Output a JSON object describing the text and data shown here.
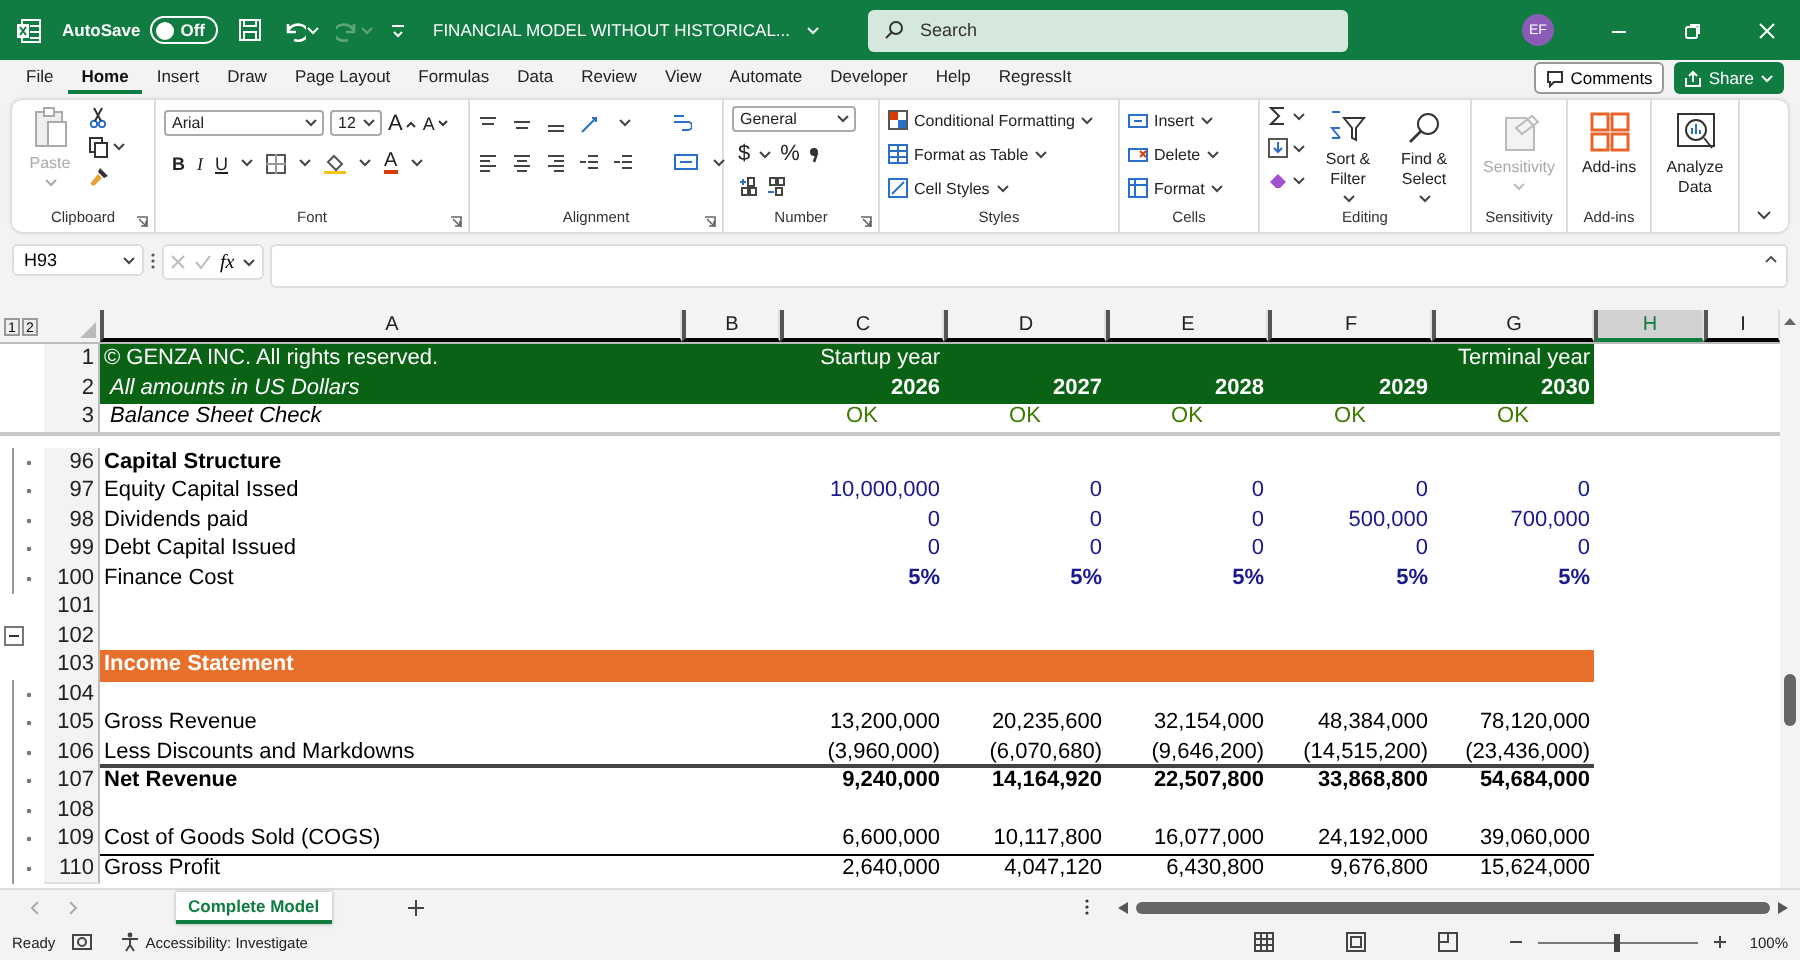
{
  "title_bar": {
    "autosave_label": "AutoSave",
    "autosave": {
      "label": "Off",
      "on": false
    },
    "redo_disabled": true,
    "document_title": "FINANCIAL MODEL WITHOUT HISTORICAL...",
    "search": {
      "placeholder": "Search"
    },
    "user_initials": "EF"
  },
  "menu": {
    "tabs": [
      {
        "label": "File",
        "selected": false
      },
      {
        "label": "Home",
        "selected": true
      },
      {
        "label": "Insert",
        "selected": false
      },
      {
        "label": "Draw",
        "selected": false
      },
      {
        "label": "Page Layout",
        "selected": false
      },
      {
        "label": "Formulas",
        "selected": false
      },
      {
        "label": "Data",
        "selected": false
      },
      {
        "label": "Review",
        "selected": false
      },
      {
        "label": "View",
        "selected": false
      },
      {
        "label": "Automate",
        "selected": false
      },
      {
        "label": "Developer",
        "selected": false
      },
      {
        "label": "Help",
        "selected": false
      },
      {
        "label": "RegressIt",
        "selected": false
      }
    ],
    "comments_button": "Comments",
    "share_button": "Share"
  },
  "ribbon": {
    "groups": [
      {
        "kind": "clipboard",
        "label": "Clipboard",
        "paste": {
          "label": "Paste",
          "disabled": true
        }
      },
      {
        "kind": "font",
        "label": "Font",
        "font_name": "Arial",
        "font_size": "12",
        "grow": "A",
        "shrink": "A",
        "bold": "B",
        "italic": "I",
        "underline": "U",
        "font_color": "A"
      },
      {
        "kind": "alignment",
        "label": "Alignment"
      },
      {
        "kind": "number",
        "label": "Number",
        "format": "General",
        "currency": "$",
        "percent": "%"
      },
      {
        "kind": "list",
        "label": "Styles",
        "items": [
          {
            "label": "Conditional Formatting"
          },
          {
            "label": "Format as Table"
          },
          {
            "label": "Cell Styles"
          }
        ]
      },
      {
        "kind": "list",
        "label": "Cells",
        "items": [
          {
            "label": "Insert"
          },
          {
            "label": "Delete"
          },
          {
            "label": "Format"
          }
        ]
      },
      {
        "kind": "editing",
        "label": "Editing",
        "buttons": [
          {
            "label": "Sort & Filter"
          },
          {
            "label": "Find & Select"
          }
        ]
      },
      {
        "kind": "sensitivity",
        "label": "Sensitivity",
        "button": {
          "label": "Sensitivity",
          "disabled": true
        }
      },
      {
        "kind": "addins",
        "label": "Add-ins",
        "button": {
          "label": "Add-ins",
          "disabled": false
        }
      },
      {
        "kind": "analyze",
        "button": {
          "label": "Analyze Data",
          "disabled": false
        }
      }
    ]
  },
  "formula_bar": {
    "name_box": "H93",
    "function_label": "fx"
  },
  "sheet": {
    "outline_levels": [
      "1",
      "2"
    ],
    "columns": [
      {
        "label": "A",
        "selected": false
      },
      {
        "label": "B",
        "selected": false
      },
      {
        "label": "C",
        "selected": false
      },
      {
        "label": "D",
        "selected": false
      },
      {
        "label": "E",
        "selected": false
      },
      {
        "label": "F",
        "selected": false
      },
      {
        "label": "G",
        "selected": false
      },
      {
        "label": "H",
        "selected": true
      },
      {
        "label": "I",
        "selected": false
      }
    ],
    "frozen_rows": [
      {
        "number": "1",
        "kind": "title",
        "cells": [
          "© GENZA INC. All rights reserved.",
          "",
          "Startup year",
          "",
          "",
          "",
          "Terminal year"
        ]
      },
      {
        "number": "2",
        "kind": "subtitle",
        "cells": [
          "All amounts in US Dollars",
          "",
          "2026",
          "2027",
          "2028",
          "2029",
          "2030"
        ]
      },
      {
        "number": "3",
        "kind": "check",
        "cells": [
          "Balance Sheet Check",
          "",
          "OK",
          "OK",
          "OK",
          "OK",
          "OK"
        ]
      }
    ],
    "rows": [
      {
        "number": "96",
        "kind": "heading",
        "grouped": true,
        "cells": [
          "Capital Structure"
        ]
      },
      {
        "number": "97",
        "kind": "input",
        "grouped": true,
        "cells": [
          "Equity Capital Issed",
          "",
          "10,000,000",
          "0",
          "0",
          "0",
          "0"
        ]
      },
      {
        "number": "98",
        "kind": "input",
        "grouped": true,
        "cells": [
          "Dividends paid",
          "",
          "0",
          "0",
          "0",
          "500,000",
          "700,000"
        ]
      },
      {
        "number": "99",
        "kind": "input",
        "grouped": true,
        "cells": [
          "Debt Capital Issued",
          "",
          "0",
          "0",
          "0",
          "0",
          "0"
        ]
      },
      {
        "number": "100",
        "kind": "input_bold",
        "grouped": true,
        "cells": [
          "Finance Cost",
          "",
          "5%",
          "5%",
          "5%",
          "5%",
          "5%"
        ]
      },
      {
        "number": "101",
        "kind": "blank",
        "grouped": false,
        "cells": []
      },
      {
        "number": "102",
        "kind": "blank",
        "grouped": false,
        "outline_toggle": {
          "expanded": true
        },
        "cells": []
      },
      {
        "number": "103",
        "kind": "band",
        "grouped": false,
        "cells": [
          "Income Statement"
        ]
      },
      {
        "number": "104",
        "kind": "blank",
        "grouped": true,
        "cells": []
      },
      {
        "number": "105",
        "kind": "data",
        "grouped": true,
        "cells": [
          "Gross Revenue",
          "",
          "13,200,000",
          "20,235,600",
          "32,154,000",
          "48,384,000",
          "78,120,000"
        ]
      },
      {
        "number": "106",
        "kind": "data_rule_thick",
        "grouped": true,
        "cells": [
          "Less Discounts and Markdowns",
          "",
          "(3,960,000)",
          "(6,070,680)",
          "(9,646,200)",
          "(14,515,200)",
          "(23,436,000)"
        ]
      },
      {
        "number": "107",
        "kind": "total",
        "grouped": true,
        "cells": [
          "Net Revenue",
          "",
          "9,240,000",
          "14,164,920",
          "22,507,800",
          "33,868,800",
          "54,684,000"
        ]
      },
      {
        "number": "108",
        "kind": "blank",
        "grouped": true,
        "cells": []
      },
      {
        "number": "109",
        "kind": "data_rule",
        "grouped": true,
        "cells": [
          "Cost of Goods Sold (COGS)",
          "",
          "6,600,000",
          "10,117,800",
          "16,077,000",
          "24,192,000",
          "39,060,000"
        ]
      },
      {
        "number": "110",
        "kind": "data",
        "grouped": true,
        "cells": [
          "Gross Profit",
          "",
          "2,640,000",
          "4,047,120",
          "6,430,800",
          "9,676,800",
          "15,624,000"
        ]
      }
    ]
  },
  "sheet_tabs": [
    {
      "label": "Complete Model",
      "selected": true
    }
  ],
  "status_bar": {
    "status": "Ready",
    "accessibility": "Accessibility: Investigate",
    "zoom": {
      "level": 0.5,
      "label": "100%"
    }
  }
}
